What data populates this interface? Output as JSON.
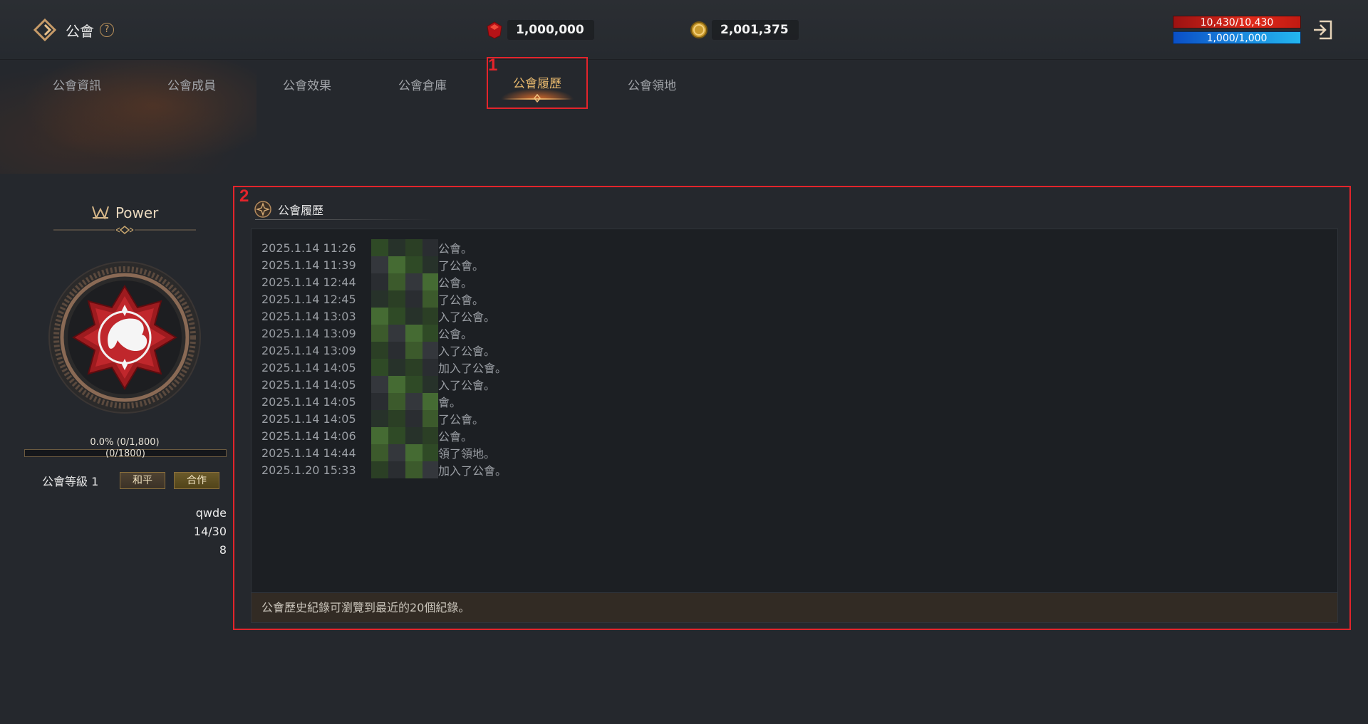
{
  "header": {
    "title": "公會",
    "help_symbol": "?",
    "gems": "1,000,000",
    "gold": "2,001,375",
    "hp": {
      "text": "10,430/10,430",
      "fraction": 1.0,
      "color": "#d4271a"
    },
    "mp": {
      "text": "1,000/1,000",
      "fraction": 1.0,
      "color": "#1a93e0"
    },
    "icons": [
      "guild-logo-icon",
      "help-icon",
      "gem-icon",
      "gold-coin-icon",
      "exit-icon"
    ]
  },
  "tabs": [
    {
      "label": "公會資訊",
      "active": false
    },
    {
      "label": "公會成員",
      "active": false
    },
    {
      "label": "公會效果",
      "active": false
    },
    {
      "label": "公會倉庫",
      "active": false
    },
    {
      "label": "公會履歷",
      "active": true
    },
    {
      "label": "公會領地",
      "active": false
    }
  ],
  "annotations": {
    "box1": "1",
    "box2": "2",
    "color": "#e3242b"
  },
  "guild": {
    "name": "Power",
    "progress_text": "0.0% (0/1,800)",
    "progress_bar_text": "(0/1800)",
    "progress_fraction": 0.0,
    "level_label": "公會等級 1",
    "peace_button": "和平",
    "coop_button": "合作",
    "info": [
      "qwde",
      "14/30",
      "8"
    ]
  },
  "history": {
    "title": "公會履歷",
    "entries": [
      {
        "time": "2025.1.14 11:26",
        "text": "公會。"
      },
      {
        "time": "2025.1.14 11:39",
        "text": "了公會。"
      },
      {
        "time": "2025.1.14 12:44",
        "text": "公會。"
      },
      {
        "time": "2025.1.14 12:45",
        "text": "了公會。"
      },
      {
        "time": "2025.1.14 13:03",
        "text": "入了公會。"
      },
      {
        "time": "2025.1.14 13:09",
        "text": "公會。"
      },
      {
        "time": "2025.1.14 13:09",
        "text": "入了公會。"
      },
      {
        "time": "2025.1.14 14:05",
        "text": "加入了公會。"
      },
      {
        "time": "2025.1.14 14:05",
        "text": "入了公會。"
      },
      {
        "time": "2025.1.14 14:05",
        "text": "會。"
      },
      {
        "time": "2025.1.14 14:05",
        "text": "了公會。"
      },
      {
        "time": "2025.1.14 14:06",
        "text": "公會。"
      },
      {
        "time": "2025.1.14 14:44",
        "text": "領了領地。"
      },
      {
        "time": "2025.1.20 15:33",
        "text": "加入了公會。"
      }
    ],
    "footer": "公會歷史紀錄可瀏覽到最近的20個紀錄。"
  },
  "colors": {
    "background": "#25282d",
    "accent_gold": "#e7b86d",
    "emblem_red": "#b51e24",
    "mask_green": "#3c5a2c"
  }
}
